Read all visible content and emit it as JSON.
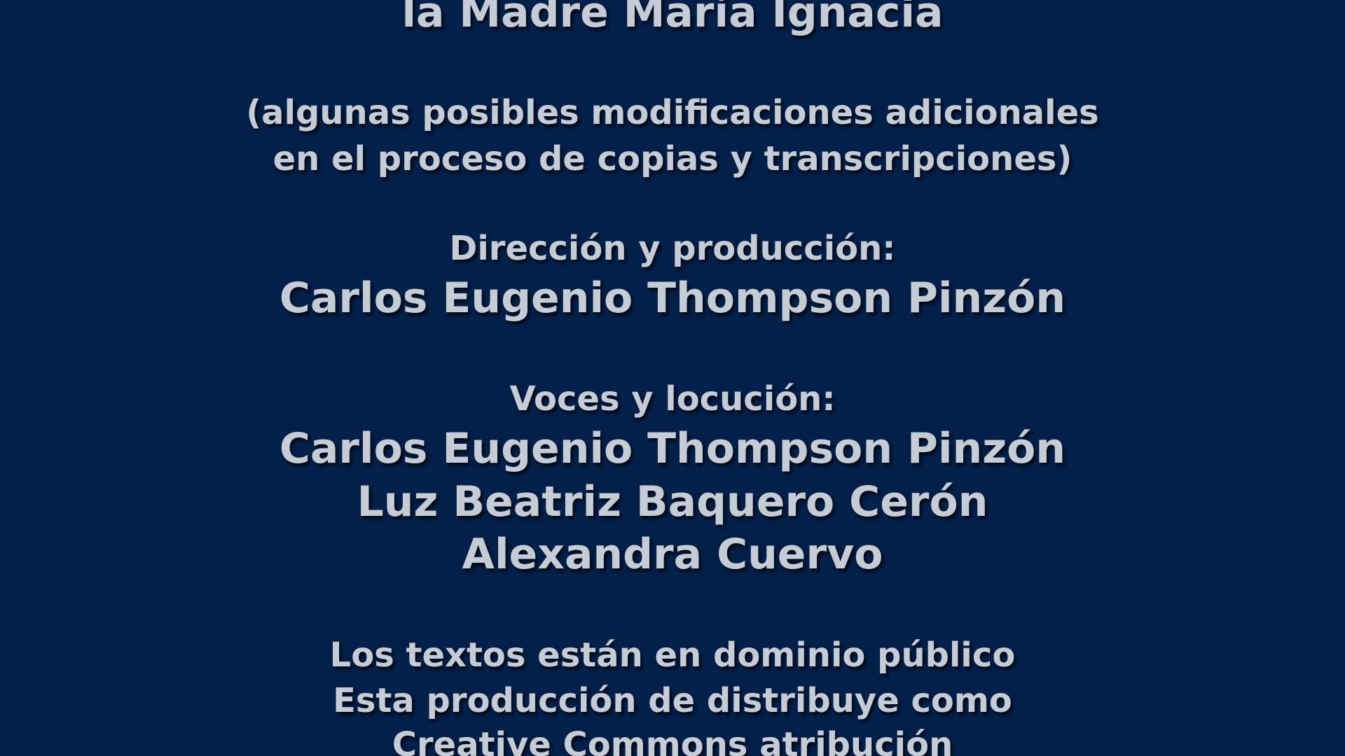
{
  "background_color": "#02204a",
  "text_color": "#c5ccd6",
  "credits": {
    "top_line": "la Madre María Ignacia",
    "note_line_1": "(algunas posibles modificaciones adicionales",
    "note_line_2": "en el proceso de copias y transcripciones)",
    "direction_heading": "Dirección y producción:",
    "director_name": "Carlos Eugenio Thompson Pinzón",
    "voices_heading": "Voces y locución:",
    "voices": [
      "Carlos Eugenio Thompson Pinzón",
      "Luz Beatriz Baquero Cerón",
      "Alexandra Cuervo"
    ],
    "license_line_1": "Los textos están en dominio público",
    "license_line_2": "Esta producción de distribuye como",
    "license_line_3": "Creative Commons atribución"
  }
}
